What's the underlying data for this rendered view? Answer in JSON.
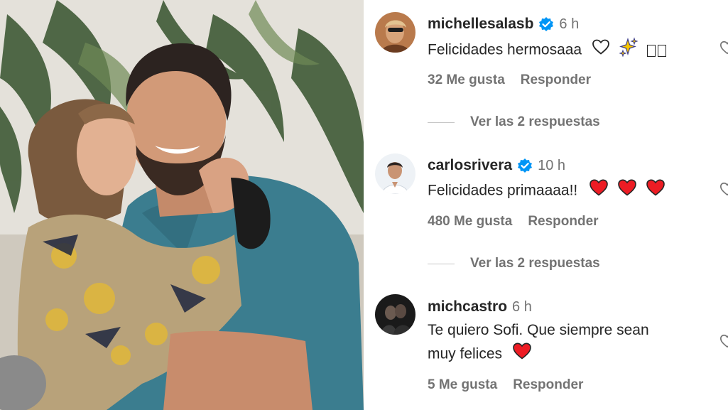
{
  "post": {
    "photo_alt": "Couple photo"
  },
  "comments": [
    {
      "username": "michellesalasb",
      "verified": true,
      "time": "6 h",
      "text": "Felicidades hermosaaa",
      "likes": "32 Me gusta",
      "reply_label": "Responder",
      "view_replies": "Ver las 2 respuestas"
    },
    {
      "username": "carlosrivera",
      "verified": true,
      "time": "10 h",
      "text": "Felicidades primaaaa!!",
      "likes": "480 Me gusta",
      "reply_label": "Responder",
      "view_replies": "Ver las 2 respuestas"
    },
    {
      "username": "michcastro",
      "verified": false,
      "time": "6 h",
      "text_line1": "Te quiero Sofi. Que siempre sean",
      "text_line2": "muy felices",
      "likes": "5 Me gusta",
      "reply_label": "Responder"
    }
  ],
  "colors": {
    "text": "#262626",
    "muted": "#737373",
    "verified": "#0095f6",
    "heart_red": "#ed1c24"
  }
}
